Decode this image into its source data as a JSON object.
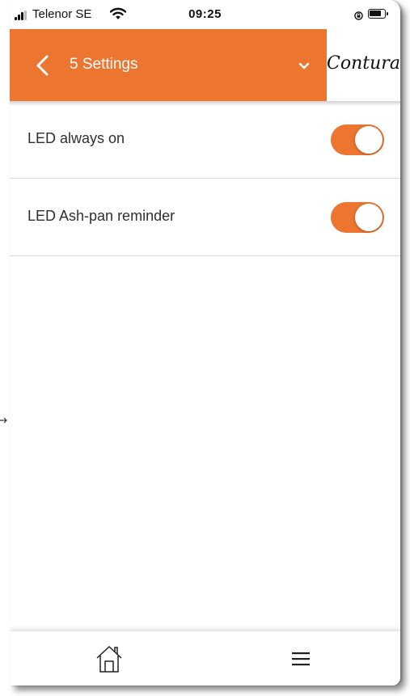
{
  "status_bar": {
    "carrier": "Telenor SE",
    "time": "09:25"
  },
  "header": {
    "title": "5 Settings",
    "brand": "Contura",
    "accent_color": "#ec7530"
  },
  "settings": [
    {
      "label": "LED always on",
      "enabled": true
    },
    {
      "label": "LED Ash-pan reminder",
      "enabled": true
    }
  ],
  "tab_bar": {
    "items": [
      {
        "icon": "home-icon"
      },
      {
        "icon": "menu-icon"
      }
    ]
  }
}
